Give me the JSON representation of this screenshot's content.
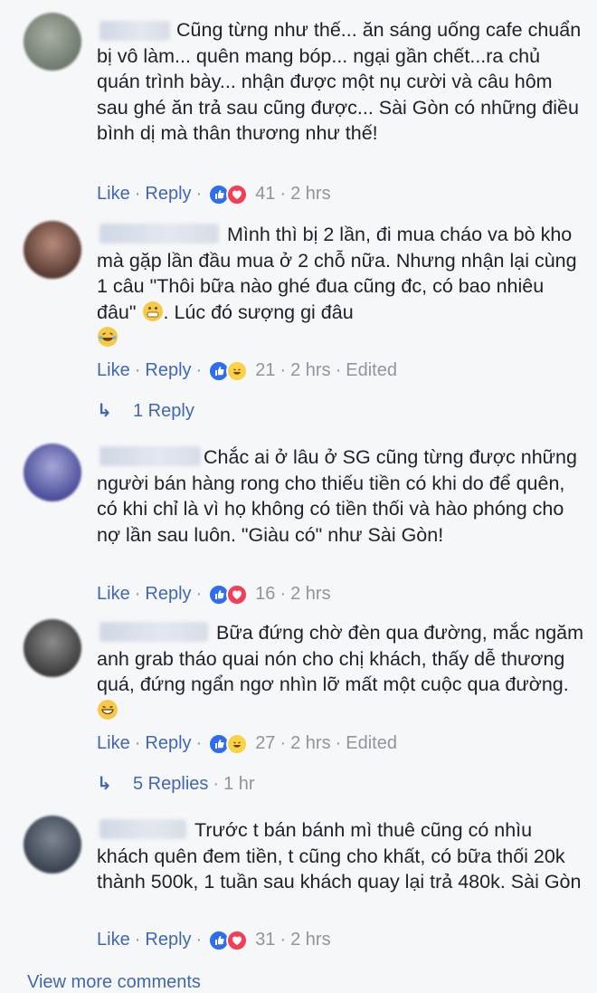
{
  "comments": [
    {
      "text": "Cũng từng như thế... ăn sáng uống cafe chuẩn bị vô làm... quên mang bóp... ngại gần chết...ra chủ quán trình bày... nhận được một nụ cười và câu hôm sau ghé ăn trả sau cũng được... Sài Gòn có những điều bình dị mà thân thương như thế!",
      "like_label": "Like",
      "reply_label": "Reply",
      "reaction_count": "41",
      "time": "2 hrs",
      "edited": "",
      "reactions": [
        "like-icon",
        "love-icon"
      ]
    },
    {
      "text": "Mình thì bị 2 lần, đi mua cháo va bò kho mà gặp lần đầu mua ở 2 chỗ nữa. Nhưng nhận lại cùng 1 câu \"Thôi bữa nào ghé đua cũng đc, có bao nhiêu đâu\"",
      "text_tail": ". Lúc đó sượng gi đâu",
      "like_label": "Like",
      "reply_label": "Reply",
      "reaction_count": "21",
      "time": "2 hrs",
      "edited": "Edited",
      "reactions": [
        "like-icon",
        "haha-icon"
      ],
      "replies_label": "1 Reply"
    },
    {
      "text": "Chắc ai ở lâu ở SG cũng từng được những người bán hàng rong cho thiếu tiền có khi do để quên, có khi chỉ là vì họ không có tiền thối và hào phóng cho nợ lần sau luôn. \"Giàu có\" như Sài Gòn!",
      "like_label": "Like",
      "reply_label": "Reply",
      "reaction_count": "16",
      "time": "2 hrs",
      "edited": "",
      "reactions": [
        "like-icon",
        "love-icon"
      ]
    },
    {
      "text": "Bữa đứng chờ đèn qua đường, mắc ngăm anh grab tháo quai nón cho chị khách, thấy dễ thương quá, đứng ngẩn ngơ nhìn lỡ mất một cuộc qua đường.",
      "like_label": "Like",
      "reply_label": "Reply",
      "reaction_count": "27",
      "time": "2 hrs",
      "edited": "Edited",
      "reactions": [
        "like-icon",
        "haha-icon"
      ],
      "replies_label": "5 Replies",
      "replies_time": "1 hr"
    },
    {
      "text": "Trước t bán bánh mì thuê cũng có nhìu khách quên đem tiền, t cũng cho khất, có bữa thối 20k thành 500k, 1 tuần sau khách quay lại trả 480k. Sài Gòn",
      "like_label": "Like",
      "reply_label": "Reply",
      "reaction_count": "31",
      "time": "2 hrs",
      "edited": "",
      "reactions": [
        "like-icon",
        "love-icon"
      ]
    }
  ],
  "footer": {
    "view_more": "View more comments"
  },
  "colors": {
    "link": "#4267b2",
    "meta": "#90949c",
    "background": "#f6f7f9"
  }
}
